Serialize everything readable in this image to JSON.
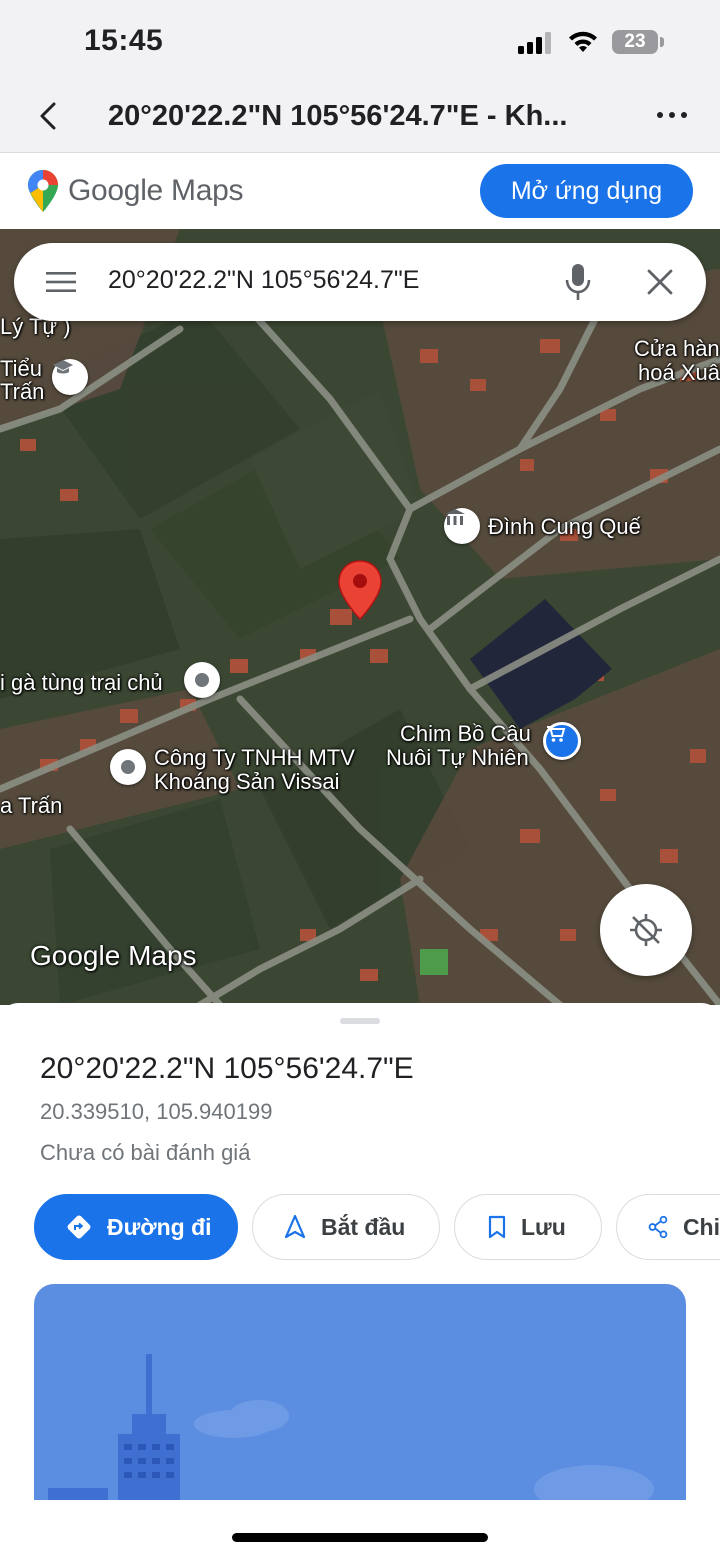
{
  "status_bar": {
    "time": "15:45",
    "battery": "23"
  },
  "browser": {
    "title": "20°20'22.2\"N 105°56'24.7\"E - Kh..."
  },
  "maps_header": {
    "logo_google": "Google",
    "logo_maps": "Maps",
    "open_app_label": "Mở ứng dụng"
  },
  "search": {
    "query": "20°20'22.2\"N 105°56'24.7\"E"
  },
  "map": {
    "labels": {
      "ly_tu": "Lý Tự )",
      "tieu": "Tiểu",
      "tran": "Trấn",
      "cua_han_1": "Cửa hàn",
      "cua_han_2": "hoá Xuâ",
      "dinh": "Đình Cung Quế",
      "ga": "i gà tùng trại chủ",
      "chim_1": "Chim Bồ Câu",
      "chim_2": "Nuôi Tự Nhiên",
      "cty_1": "Công Ty TNHH MTV",
      "cty_2": "Khoáng Sản Vissai",
      "a_tran": "a Trấn"
    },
    "watermark": "Google Maps"
  },
  "place": {
    "title": "20°20'22.2\"N 105°56'24.7\"E",
    "coords": "20.339510, 105.940199",
    "review": "Chưa có bài đánh giá"
  },
  "actions": [
    {
      "label": "Đường đi",
      "icon": "directions-icon"
    },
    {
      "label": "Bắt đầu",
      "icon": "navigation-icon"
    },
    {
      "label": "Lưu",
      "icon": "bookmark-icon"
    },
    {
      "label": "Chi",
      "icon": "share-icon"
    }
  ],
  "colors": {
    "accent": "#1a73e8",
    "pin": "#ea4335",
    "illustration": "#5b8de0"
  }
}
